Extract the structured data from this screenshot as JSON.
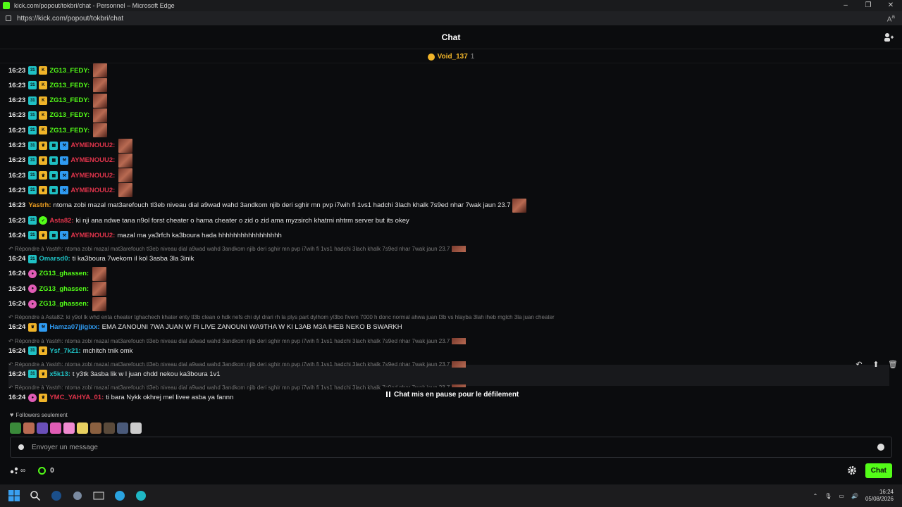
{
  "window": {
    "title": "kick.com/popout/tokbri/chat - Personnel – Microsoft Edge",
    "url": "https://kick.com/popout/tokbri/chat"
  },
  "header": {
    "title": "Chat"
  },
  "pinned": {
    "name": "Void_137",
    "count": "1"
  },
  "messages": [
    {
      "time": "16:23",
      "user": "ZG13_FEDY",
      "color": "#53fc18",
      "badges": [
        "sub",
        "k"
      ],
      "text": "",
      "emote": true
    },
    {
      "time": "16:23",
      "user": "ZG13_FEDY",
      "color": "#53fc18",
      "badges": [
        "sub",
        "k"
      ],
      "text": "",
      "emote": true
    },
    {
      "time": "16:23",
      "user": "ZG13_FEDY",
      "color": "#53fc18",
      "badges": [
        "sub",
        "k"
      ],
      "text": "",
      "emote": true
    },
    {
      "time": "16:23",
      "user": "ZG13_FEDY",
      "color": "#53fc18",
      "badges": [
        "sub",
        "k"
      ],
      "text": "",
      "emote": true
    },
    {
      "time": "16:23",
      "user": "ZG13_FEDY",
      "color": "#53fc18",
      "badges": [
        "sub",
        "k"
      ],
      "text": "",
      "emote": true
    },
    {
      "time": "16:23",
      "user": "AYMENOUU2",
      "color": "#e0344b",
      "badges": [
        "sub",
        "crown",
        "gift",
        "hammer"
      ],
      "text": "",
      "emote": true
    },
    {
      "time": "16:23",
      "user": "AYMENOUU2",
      "color": "#e0344b",
      "badges": [
        "sub",
        "crown",
        "gift",
        "hammer"
      ],
      "text": "",
      "emote": true
    },
    {
      "time": "16:23",
      "user": "AYMENOUU2",
      "color": "#e0344b",
      "badges": [
        "sub",
        "crown",
        "gift",
        "hammer"
      ],
      "text": "",
      "emote": true
    },
    {
      "time": "16:23",
      "user": "AYMENOUU2",
      "color": "#e0344b",
      "badges": [
        "sub",
        "crown",
        "gift",
        "hammer"
      ],
      "text": "",
      "emote": true
    },
    {
      "time": "16:23",
      "user": "Yastrh",
      "color": "#f0a020",
      "badges": [],
      "text": "ntoma zobi mazal mat3arefouch tl3eb niveau dial a9wad wahd 3andkom njib deri sghir mn pvp i7wih fi 1vs1 hadchi 3lach khalk 7s9ed nhar 7wak jaun 23.7",
      "emote": true
    },
    {
      "time": "16:23",
      "user": "Asta82",
      "color": "#e0344b",
      "badges": [
        "sub",
        "green"
      ],
      "text": "ki nji ana ndwe tana n9ol forst cheater o hama cheater o zid o zid ama myzsirch khatrni nhtrm server but its okey",
      "emote": false
    },
    {
      "time": "16:24",
      "user": "AYMENOUU2",
      "color": "#e0344b",
      "badges": [
        "sub",
        "crown",
        "gift",
        "hammer"
      ],
      "text": "mazal ma ya3rfch ka3boura hada hhhhhhhhhhhhhhhhh",
      "emote": false
    },
    {
      "time": "16:24",
      "user": "Omarsd0",
      "color": "#1fc1c4",
      "badges": [
        "sub"
      ],
      "text": "ti ka3boura 7wekom il kol 3asba 3la 3inik",
      "emote": false,
      "reply": "Répondre à Yastrh: ntoma zobi mazal mat3arefouch tl3eb niveau dial a9wad wahd 3andkom njib deri sghir mn pvp i7wih fi 1vs1 hadchi 3lach khalk 7s9ed nhar 7wak jaun 23.7"
    },
    {
      "time": "16:24",
      "user": "ZG13_ghassen",
      "color": "#53fc18",
      "badges": [
        "pink"
      ],
      "text": "",
      "emote": true
    },
    {
      "time": "16:24",
      "user": "ZG13_ghassen",
      "color": "#53fc18",
      "badges": [
        "pink"
      ],
      "text": "",
      "emote": true
    },
    {
      "time": "16:24",
      "user": "ZG13_ghassen",
      "color": "#53fc18",
      "badges": [
        "pink"
      ],
      "text": "",
      "emote": true
    },
    {
      "time": "16:24",
      "user": "Hamza07jjigixx",
      "color": "#2f9bf2",
      "badges": [
        "crown",
        "hammer"
      ],
      "text": "EMA ZANOUNI 7WA JUAN W FI LIVE ZANOUNI WA9THA W KI L3AB M3A IHEB NEKO B SWARKH",
      "emote": false,
      "reply": "Répondre à Asta82: ki y9ol lk whd enta cheater tghachech khater enty tl3b clean o hdk nefs chi dyl drari rh la plys part dylhom yl3bo fivem 7000 h donc normal ahwa juan l3b vs hlayba 3lah iheb mglch 3la juan cheater"
    },
    {
      "time": "16:24",
      "user": "Ysf_7k21",
      "color": "#1fc1c4",
      "badges": [
        "sub",
        "crown"
      ],
      "text": "mchitch tnik omk",
      "emote": false,
      "reply": "Répondre à Yastrh: ntoma zobi mazal mat3arefouch tl3eb niveau dial a9wad wahd 3andkom njib deri sghir mn pvp i7wih fi 1vs1 hadchi 3lach khalk 7s9ed nhar 7wak jaun 23.7"
    },
    {
      "time": "16:24",
      "user": "x5k13",
      "color": "#1fc1c4",
      "badges": [
        "sub",
        "crown"
      ],
      "text": "t y3tk 3asba lik w l juan chdd nekou ka3boura 1v1",
      "emote": false,
      "reply": "Répondre à Yastrh: ntoma zobi mazal mat3arefouch tl3eb niveau dial a9wad wahd 3andkom njib deri sghir mn pvp i7wih fi 1vs1 hadchi 3lach khalk 7s9ed nhar 7wak jaun 23.7"
    },
    {
      "time": "16:24",
      "user": "YMC_YAHYA_01",
      "color": "#e0344b",
      "badges": [
        "pink",
        "crown"
      ],
      "text": "ti bara Nykk okhrej mel livee asba ya fannn",
      "emote": false,
      "reply": "Répondre à Yastrh: ntoma zobi mazal mat3arefouch tl3eb niveau dial a9wad wahd 3andkom njib deri sghir mn pvp i7wih fi 1vs1 hadchi 3lach khalk 7s9ed nhar 7wak jaun 23.7"
    }
  ],
  "paused_label": "Chat mis en pause pour le défilement",
  "followers_label": "Followers seulement",
  "input": {
    "placeholder": "Envoyer un message"
  },
  "bottom": {
    "infinity": "∞",
    "points": "0",
    "chat_button": "Chat"
  },
  "taskbar": {
    "time": "16:24",
    "date": "05/08/2026"
  }
}
